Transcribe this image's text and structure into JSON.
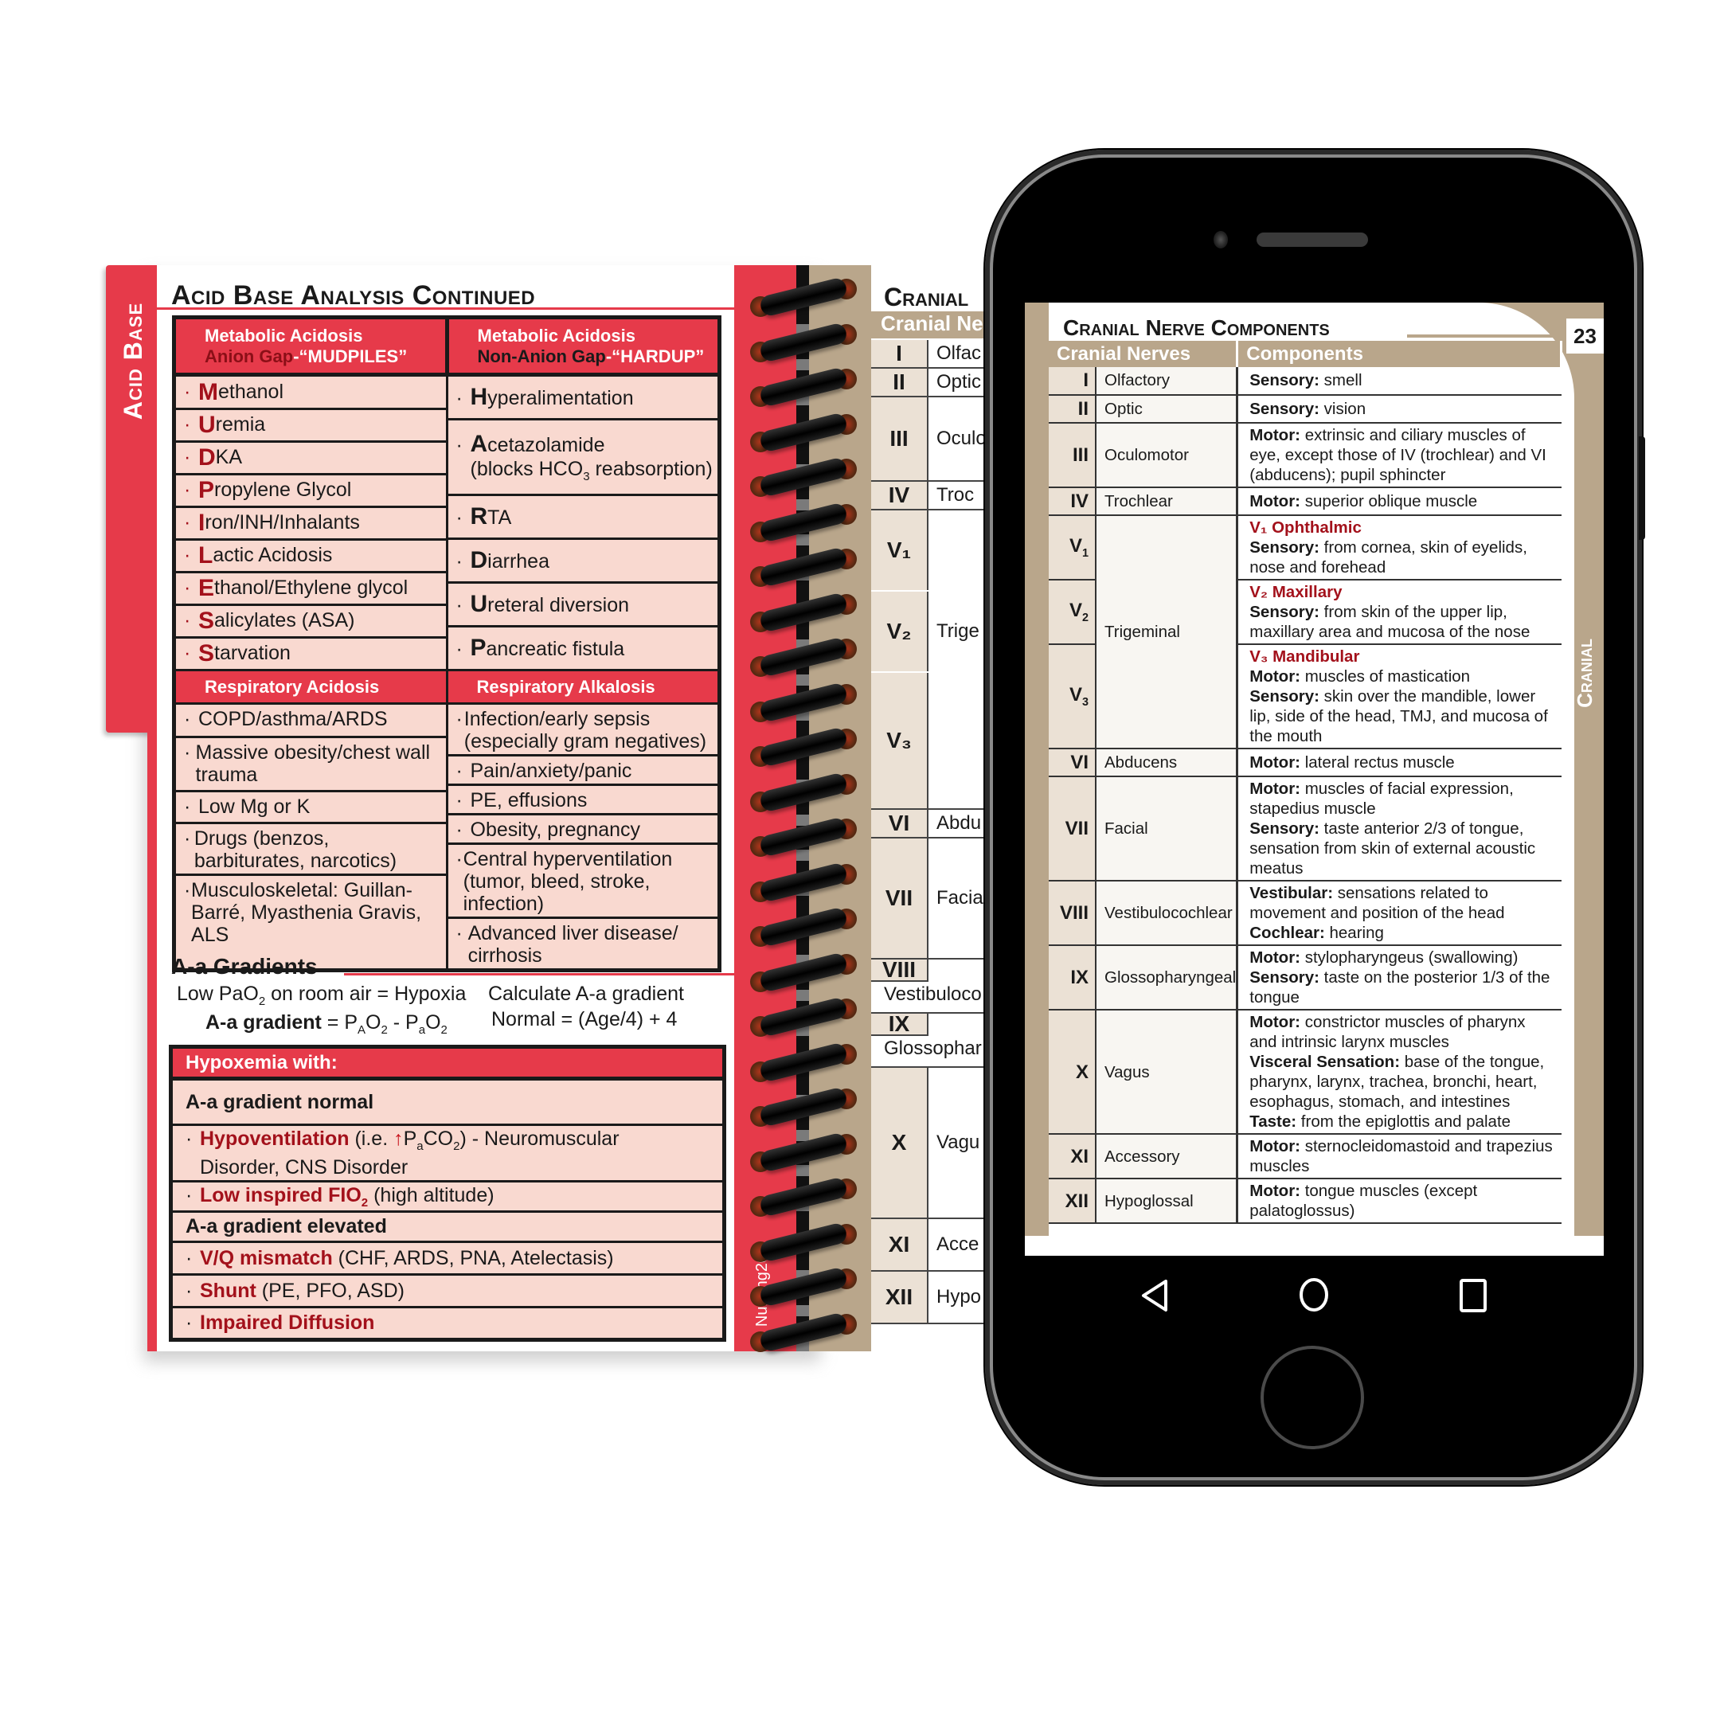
{
  "book": {
    "side_tab": "Acid Base",
    "page_title": "Acid Base Analysis Continued",
    "spine_text": "Nursing20",
    "metabolic": {
      "left_header": {
        "line1": "Metabolic Acidosis",
        "line2_bold": "Anion Gap",
        "line2_rest": "-“MUDPILES”"
      },
      "right_header": {
        "line1": "Metabolic Acidosis",
        "line2_bold": "Non-Anion Gap",
        "line2_rest": "-“HARDUP”"
      },
      "mudpiles": [
        {
          "letter": "M",
          "rest": "ethanol"
        },
        {
          "letter": "U",
          "rest": "remia"
        },
        {
          "letter": "D",
          "rest": "KA"
        },
        {
          "letter": "P",
          "rest": "ropylene Glycol"
        },
        {
          "letter": "I",
          "rest": "ron/INH/Inhalants"
        },
        {
          "letter": "L",
          "rest": "actic Acidosis"
        },
        {
          "letter": "E",
          "rest": "thanol/Ethylene glycol"
        },
        {
          "letter": "S",
          "rest": "alicylates (ASA)"
        },
        {
          "letter": "S",
          "rest": "tarvation"
        }
      ],
      "hardup": [
        {
          "letter": "H",
          "rest": "yperalimentation",
          "extra": ""
        },
        {
          "letter": "A",
          "rest": "cetazolamide",
          "extra": "(blocks HCO",
          "extra_sub": "3",
          "extra_end": " reabsorption)"
        },
        {
          "letter": "R",
          "rest": "TA",
          "extra": ""
        },
        {
          "letter": "D",
          "rest": "iarrhea",
          "extra": ""
        },
        {
          "letter": "U",
          "rest": "reteral diversion",
          "extra": ""
        },
        {
          "letter": "P",
          "rest": "ancreatic fistula",
          "extra": ""
        }
      ]
    },
    "respiratory": {
      "left_header": "Respiratory Acidosis",
      "right_header": "Respiratory Alkalosis",
      "acidosis": [
        "COPD/asthma/ARDS",
        "Massive obesity/chest wall trauma",
        "Low Mg or K",
        "Drugs (benzos, barbiturates, narcotics)",
        "Musculoskeletal: Guillan-Barré, Myasthenia Gravis, ALS"
      ],
      "alkalosis": [
        "Infection/early sepsis (especially gram negatives)",
        "Pain/anxiety/panic",
        "PE, effusions",
        "Obesity, pregnancy",
        "Central hyperventilation (tumor, bleed, stroke, infection)",
        "Advanced liver disease/ cirrhosis"
      ]
    },
    "aa_gradients": {
      "heading": "A-a Gradients",
      "line1_a": "Low PaO",
      "line1_b": " on room air = Hypoxia",
      "line1_c": "Calculate A-a gradient",
      "formula_label": "A-a gradient",
      "formula": " = P",
      "normal": "Normal =  (Age/4) + 4"
    },
    "hypoxemia": {
      "header": "Hypoxemia with:",
      "normal_label": "A-a gradient normal",
      "hypovent_red": "Hypoventilation",
      "hypovent_rest_a": " (i.e. ",
      "hypovent_rest_b": ") - Neuromuscular",
      "hypovent_line2": "Disorder, CNS Disorder",
      "low_fio2_red": "Low inspired FIO",
      "low_fio2_rest": " (high altitude)",
      "elevated_label": "A-a gradient elevated",
      "items": [
        {
          "red": "V/Q mismatch",
          "rest": " (CHF, ARDS, PNA, Atelectasis)"
        },
        {
          "red": "Shunt",
          "rest": " (PE, PFO, ASD)"
        },
        {
          "red": "Impaired Diffusion",
          "rest": ""
        }
      ]
    }
  },
  "back_page": {
    "title": "Cranial",
    "header": "Cranial Ne",
    "rows": [
      {
        "num": "I",
        "name": "Olfac"
      },
      {
        "num": "II",
        "name": "Optic"
      },
      {
        "num": "III",
        "name": "Oculo"
      },
      {
        "num": "IV",
        "name": "Troc"
      },
      {
        "num": "V₁",
        "name": ""
      },
      {
        "num": "V₂",
        "name": "Trige"
      },
      {
        "num": "V₃",
        "name": ""
      },
      {
        "num": "VI",
        "name": "Abdu"
      },
      {
        "num": "VII",
        "name": "Facia"
      },
      {
        "num": "VIII",
        "name": "Vestibuloco"
      },
      {
        "num": "IX",
        "name": "Glossophar"
      },
      {
        "num": "X",
        "name": "Vagu"
      },
      {
        "num": "XI",
        "name": "Acce"
      },
      {
        "num": "XII",
        "name": "Hypo"
      }
    ]
  },
  "phone": {
    "screen": {
      "title": "Cranial Nerve Components",
      "page_number": "23",
      "side_label": "Cranial",
      "col_headers": [
        "Cranial Nerves",
        "Components"
      ],
      "rows": [
        {
          "num": "I",
          "name": "Olfactory",
          "components": [
            {
              "label": "Sensory:",
              "text": " smell"
            }
          ]
        },
        {
          "num": "II",
          "name": "Optic",
          "components": [
            {
              "label": "Sensory:",
              "text": " vision"
            }
          ]
        },
        {
          "num": "III",
          "name": "Oculomotor",
          "components": [
            {
              "label": "Motor:",
              "text": " extrinsic and ciliary muscles of eye, except those of IV (trochlear) and VI (abducens); pupil sphincter"
            }
          ]
        },
        {
          "num": "IV",
          "name": "Trochlear",
          "components": [
            {
              "label": "Motor:",
              "text": " superior oblique muscle"
            }
          ]
        },
        {
          "num": "V1",
          "name": "Trigeminal",
          "subtitle": "V₁ Ophthalmic",
          "components": [
            {
              "label": "Sensory:",
              "text": " from cornea, skin of eyelids, nose and forehead"
            }
          ]
        },
        {
          "num": "V2",
          "name": "",
          "subtitle": "V₂ Maxillary",
          "components": [
            {
              "label": "Sensory:",
              "text": " from skin of the upper lip, maxillary area and mucosa of the nose"
            }
          ]
        },
        {
          "num": "V3",
          "name": "",
          "subtitle": "V₃ Mandibular",
          "components": [
            {
              "label": "Motor:",
              "text": " muscles of mastication"
            },
            {
              "label": "Sensory:",
              "text": " skin over the mandible, lower lip, side of the head, TMJ, and mucosa of the mouth"
            }
          ]
        },
        {
          "num": "VI",
          "name": "Abducens",
          "components": [
            {
              "label": "Motor:",
              "text": " lateral rectus muscle"
            }
          ]
        },
        {
          "num": "VII",
          "name": "Facial",
          "components": [
            {
              "label": "Motor:",
              "text": " muscles of facial expression, stapedius muscle"
            },
            {
              "label": "Sensory:",
              "text": " taste anterior 2/3 of tongue, sensation from skin of external acoustic meatus"
            }
          ]
        },
        {
          "num": "VIII",
          "name": "Vestibulocochlear",
          "components": [
            {
              "label": "Vestibular:",
              "text": " sensations related to movement and position of the head"
            },
            {
              "label": "Cochlear:",
              "text": " hearing"
            }
          ]
        },
        {
          "num": "IX",
          "name": "Glossopharyngeal",
          "components": [
            {
              "label": "Motor:",
              "text": " stylopharyngeus (swallowing)"
            },
            {
              "label": "Sensory:",
              "text": " taste on the posterior 1/3 of the tongue"
            }
          ]
        },
        {
          "num": "X",
          "name": "Vagus",
          "components": [
            {
              "label": "Motor:",
              "text": " constrictor muscles of pharynx and intrinsic larynx muscles"
            },
            {
              "label": "Visceral Sensation:",
              "text": " base of the tongue, pharynx, larynx, trachea, bronchi, heart, esophagus, stomach, and intestines"
            },
            {
              "label": "Taste:",
              "text": " from the epiglottis and palate"
            }
          ]
        },
        {
          "num": "XI",
          "name": "Accessory",
          "components": [
            {
              "label": "Motor:",
              "text": " sternocleidomastoid and trapezius muscles"
            }
          ]
        },
        {
          "num": "XII",
          "name": "Hypoglossal",
          "components": [
            {
              "label": "Motor:",
              "text": " tongue muscles (except palatoglossus)"
            }
          ]
        }
      ]
    },
    "nav": {
      "back_icon": "triangle-back-icon",
      "home_icon": "circle-home-icon",
      "recents_icon": "square-recents-icon"
    }
  },
  "colors": {
    "book_red": "#e63a4a",
    "dark_red_text": "#a3111b",
    "cell_pink": "#f9d9d0",
    "tan": "#b9a68b",
    "tan_light": "#ebe1d5"
  }
}
